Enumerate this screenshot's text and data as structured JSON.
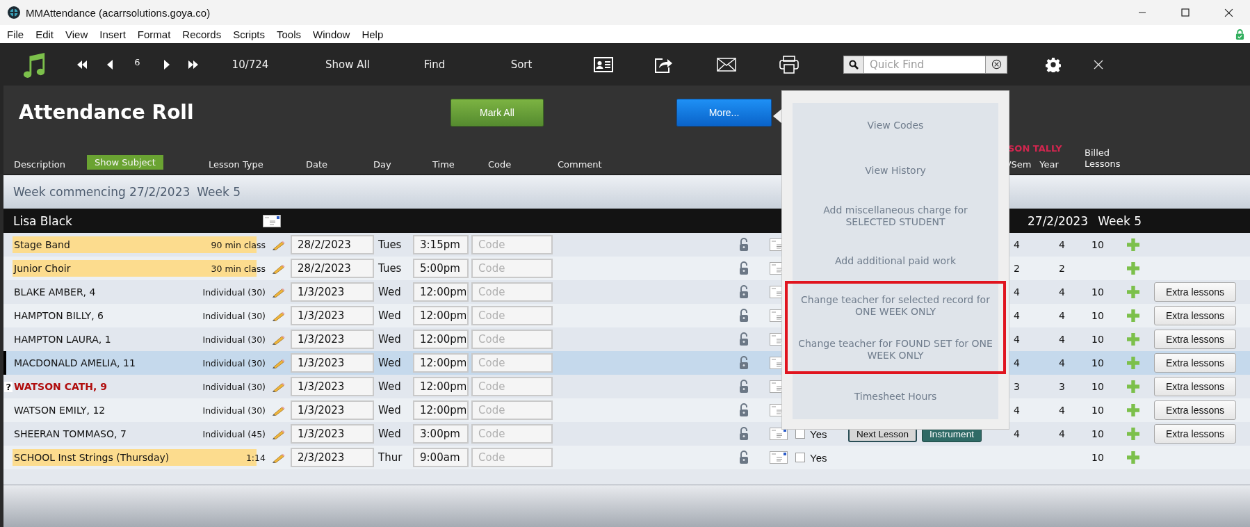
{
  "window": {
    "title": "MMAttendance (acarrsolutions.goya.co)"
  },
  "menu": [
    "File",
    "Edit",
    "View",
    "Insert",
    "Format",
    "Records",
    "Scripts",
    "Tools",
    "Window",
    "Help"
  ],
  "toolbar": {
    "record": "6",
    "count": "10/724",
    "actions": [
      "Show All",
      "Find",
      "Sort"
    ],
    "quick_find": {
      "placeholder": "Quick Find"
    }
  },
  "header": {
    "title": "Attendance Roll",
    "mark_all_button": "Mark All",
    "more_button": "More..."
  },
  "columns": {
    "description": "Description",
    "show_subject": "Show Subject",
    "lesson_type": "Lesson Type",
    "date": "Date",
    "day": "Day",
    "time": "Time",
    "code": "Code",
    "comment": "Comment",
    "tally_title": "SON TALLY",
    "tally_sem": "/Sem",
    "tally_year": "Year",
    "billed": "Billed Lessons"
  },
  "week_banner": {
    "commencing": "Week commencing 27/2/2023",
    "week": "Week 5"
  },
  "teacher_band": {
    "name": "Lisa Black",
    "date": "27/2/2023",
    "week": "Week 5"
  },
  "rows": [
    {
      "kind": "class",
      "name": "Stage Band",
      "lesson_type": "90 min class",
      "date": "28/2/2023",
      "day": "Tues",
      "time": "3:15pm",
      "code": {
        "placeholder": "Code"
      },
      "selected": false,
      "alert": false,
      "tally": [
        "4",
        "4"
      ],
      "billed": "10"
    },
    {
      "kind": "class",
      "name": "Junior Choir",
      "lesson_type": "30 min class",
      "date": "28/2/2023",
      "day": "Tues",
      "time": "5:00pm",
      "code": {
        "placeholder": "Code"
      },
      "selected": false,
      "alert": false,
      "tally": [
        "2",
        "2"
      ]
    },
    {
      "kind": "student",
      "name": "BLAKE AMBER, 4",
      "lesson_type": "Individual (30)",
      "date": "1/3/2023",
      "day": "Wed",
      "time": "12:00pm",
      "code": {
        "placeholder": "Code"
      },
      "selected": false,
      "alert": false,
      "tally": [
        "4",
        "4"
      ],
      "billed": "10",
      "extra_button": "Extra lessons"
    },
    {
      "kind": "student",
      "name": "HAMPTON BILLY, 6",
      "lesson_type": "Individual (30)",
      "date": "1/3/2023",
      "day": "Wed",
      "time": "12:00pm",
      "code": {
        "placeholder": "Code"
      },
      "selected": false,
      "alert": false,
      "tally": [
        "4",
        "4"
      ],
      "billed": "10",
      "extra_button": "Extra lessons"
    },
    {
      "kind": "student",
      "name": "HAMPTON LAURA, 1",
      "lesson_type": "Individual (30)",
      "date": "1/3/2023",
      "day": "Wed",
      "time": "12:00pm",
      "code": {
        "placeholder": "Code"
      },
      "selected": false,
      "alert": false,
      "tally": [
        "4",
        "4"
      ],
      "billed": "10",
      "extra_button": "Extra lessons"
    },
    {
      "kind": "student",
      "name": "MACDONALD AMELIA, 11",
      "lesson_type": "Individual (30)",
      "date": "1/3/2023",
      "day": "Wed",
      "time": "12:00pm",
      "code": {
        "placeholder": "Code"
      },
      "selected": true,
      "alert": false,
      "tally": [
        "4",
        "4"
      ],
      "billed": "10",
      "extra_button": "Extra lessons"
    },
    {
      "kind": "student",
      "flag": "?",
      "name": "WATSON CATH, 9",
      "lesson_type": "Individual (30)",
      "date": "1/3/2023",
      "day": "Wed",
      "time": "12:00pm",
      "code": {
        "placeholder": "Code"
      },
      "selected": false,
      "alert": true,
      "tally": [
        "3",
        "3"
      ],
      "billed": "10",
      "extra_button": "Extra lessons"
    },
    {
      "kind": "student",
      "name": "WATSON EMILY, 12",
      "lesson_type": "Individual (30)",
      "date": "1/3/2023",
      "day": "Wed",
      "time": "12:00pm",
      "code": {
        "placeholder": "Code"
      },
      "selected": false,
      "alert": false,
      "tally": [
        "4",
        "4"
      ],
      "billed": "10",
      "extra_button": "Extra lessons"
    },
    {
      "kind": "student",
      "name": "SHEERAN TOMMASO, 7",
      "lesson_type": "Individual (45)",
      "date": "1/3/2023",
      "day": "Wed",
      "time": "3:00pm",
      "code": {
        "placeholder": "Code"
      },
      "selected": false,
      "alert": false,
      "enrolled": {
        "label": "Yes",
        "checked": false
      },
      "next_button": "Next Lesson",
      "instrument_button": "Instrument",
      "tally": [
        "4",
        "4"
      ],
      "billed": "10",
      "extra_button": "Extra lessons"
    },
    {
      "kind": "class",
      "name": "SCHOOL Inst Strings (Thursday)",
      "lesson_type": "1:14",
      "date": "2/3/2023",
      "day": "Thur",
      "time": "9:00am",
      "code": {
        "placeholder": "Code"
      },
      "selected": false,
      "alert": false,
      "enrolled": {
        "label": "Yes",
        "checked": false
      },
      "billed": "10"
    }
  ],
  "popover": {
    "items": [
      {
        "label": "View Codes",
        "highlighted": false
      },
      {
        "label": "View History",
        "highlighted": false
      },
      {
        "label": "Add miscellaneous charge for SELECTED STUDENT",
        "highlighted": false
      },
      {
        "label": "Add additional paid work",
        "highlighted": false
      },
      {
        "label": "Change teacher for selected record for ONE WEEK ONLY",
        "highlighted": true
      },
      {
        "label": "Change teacher for FOUND SET for ONE WEEK ONLY",
        "highlighted": true
      },
      {
        "label": "Timesheet Hours",
        "highlighted": false
      }
    ]
  }
}
